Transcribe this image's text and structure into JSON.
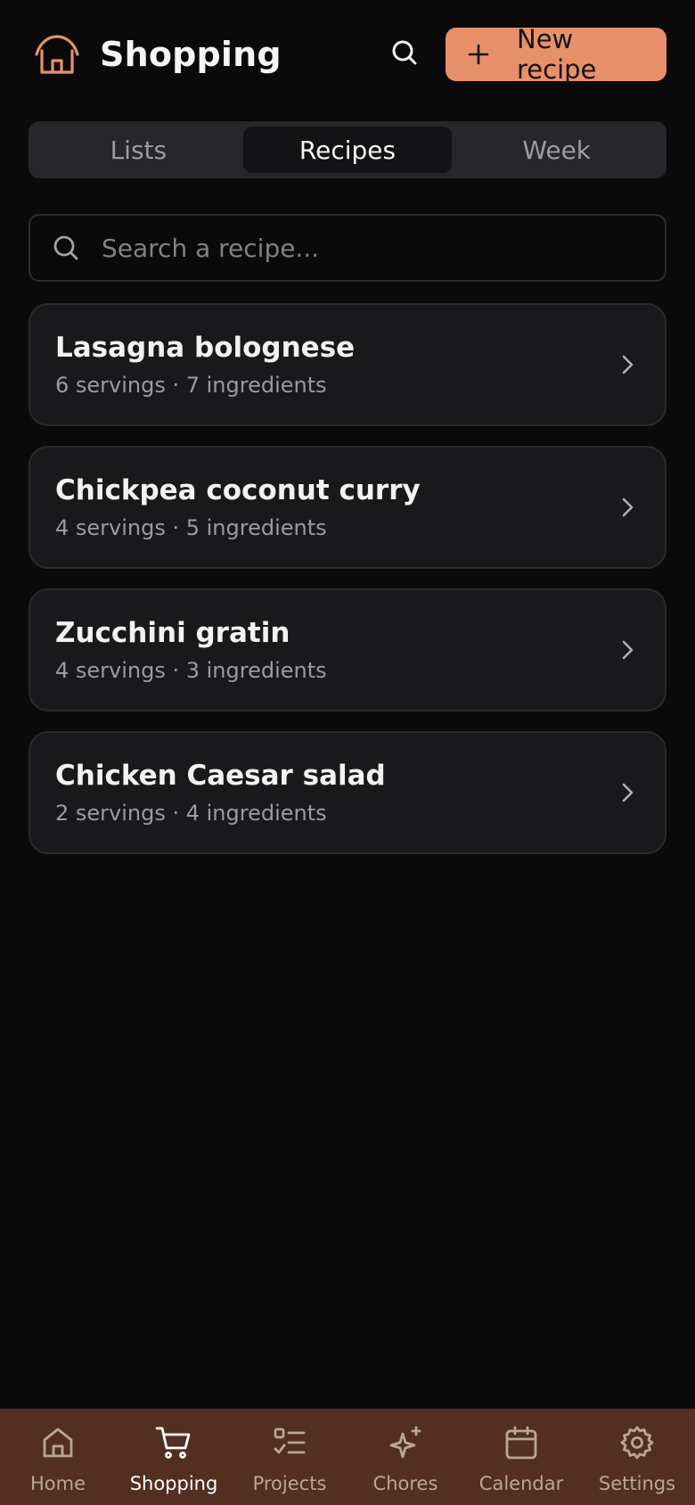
{
  "header": {
    "title": "Shopping",
    "logo_icon": "house-icon",
    "search_icon": "search-icon",
    "new_button_label": "New recipe",
    "new_button_icon": "plus-icon"
  },
  "tabs": [
    {
      "label": "Lists",
      "active": false
    },
    {
      "label": "Recipes",
      "active": true
    },
    {
      "label": "Week",
      "active": false
    }
  ],
  "search": {
    "placeholder": "Search a recipe...",
    "value": ""
  },
  "recipes": [
    {
      "name": "Lasagna bolognese",
      "meta": "6 servings · 7 ingredients"
    },
    {
      "name": "Chickpea coconut curry",
      "meta": "4 servings · 5 ingredients"
    },
    {
      "name": "Zucchini gratin",
      "meta": "4 servings · 3 ingredients"
    },
    {
      "name": "Chicken Caesar salad",
      "meta": "2 servings · 4 ingredients"
    }
  ],
  "nav": [
    {
      "label": "Home",
      "icon": "home-icon",
      "active": false
    },
    {
      "label": "Shopping",
      "icon": "cart-icon",
      "active": true
    },
    {
      "label": "Projects",
      "icon": "checklist-icon",
      "active": false
    },
    {
      "label": "Chores",
      "icon": "sparkles-icon",
      "active": false
    },
    {
      "label": "Calendar",
      "icon": "calendar-icon",
      "active": false
    },
    {
      "label": "Settings",
      "icon": "gear-icon",
      "active": false
    }
  ],
  "colors": {
    "accent": "#e8906a",
    "background": "#0a0a0a",
    "card": "#19191c",
    "nav_bg": "#532f21"
  }
}
